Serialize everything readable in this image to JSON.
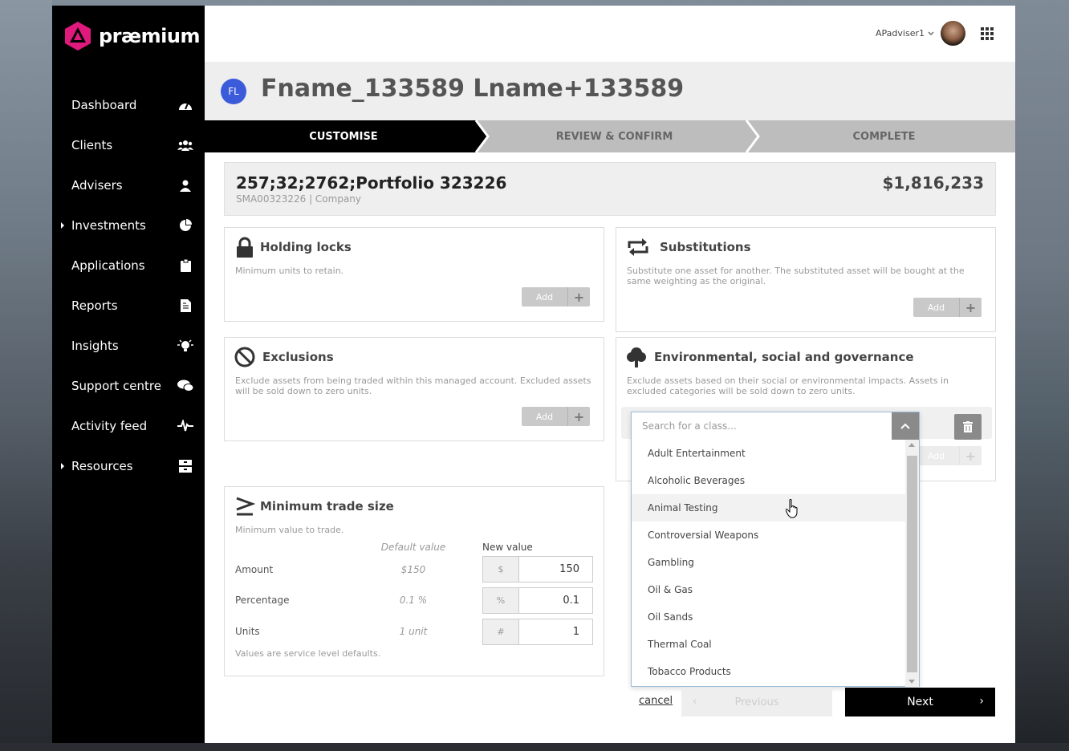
{
  "brand": {
    "name": "præmium",
    "colors": {
      "accent": "#e0197d",
      "avatar_blue": "#3b5bdb",
      "sidebar": "#000000"
    }
  },
  "topbar": {
    "username": "APadviser1",
    "apps_icon": "grid-icon"
  },
  "sidebar": {
    "items": [
      {
        "label": "Dashboard",
        "icon": "speedometer-icon"
      },
      {
        "label": "Clients",
        "icon": "users-icon"
      },
      {
        "label": "Advisers",
        "icon": "user-icon"
      },
      {
        "label": "Investments",
        "icon": "pie-chart-icon"
      },
      {
        "label": "Applications",
        "icon": "clipboard-icon"
      },
      {
        "label": "Reports",
        "icon": "document-icon"
      },
      {
        "label": "Insights",
        "icon": "lightbulb-icon"
      },
      {
        "label": "Support centre",
        "icon": "chat-icon"
      },
      {
        "label": "Activity feed",
        "icon": "pulse-icon"
      },
      {
        "label": "Resources",
        "icon": "archive-icon"
      }
    ]
  },
  "header": {
    "initials": "FL",
    "client_name": "Fname_133589 Lname+133589"
  },
  "steps": [
    "CUSTOMISE",
    "REVIEW & CONFIRM",
    "COMPLETE"
  ],
  "portfolio": {
    "title": "257;32;2762;Portfolio 323226",
    "subtitle": "SMA00323226 | Company",
    "value": "$1,816,233"
  },
  "holding_locks": {
    "title": "Holding locks",
    "desc": "Minimum units to retain.",
    "add": "Add"
  },
  "substitutions": {
    "title": "Substitutions",
    "desc": "Substitute one asset for another. The substituted asset will be bought at the same weighting as the original.",
    "add": "Add"
  },
  "exclusions": {
    "title": "Exclusions",
    "desc": "Exclude assets from being traded within this managed account. Excluded assets will be sold down to zero units.",
    "add": "Add"
  },
  "esg": {
    "title": "Environmental, social and governance",
    "desc": "Exclude assets based on their social or environmental impacts. Assets in excluded categories will be sold down to zero units.",
    "add": "Add"
  },
  "min_trade": {
    "title": "Minimum trade size",
    "desc": "Minimum value to trade.",
    "col_default": "Default value",
    "col_new": "New value",
    "rows": [
      {
        "label": "Amount",
        "default": "$150",
        "prefix": "$",
        "value": "150"
      },
      {
        "label": "Percentage",
        "default": "0.1 %",
        "prefix": "%",
        "value": "0.1"
      },
      {
        "label": "Units",
        "default": "1 unit",
        "prefix": "#",
        "value": "1"
      }
    ],
    "footnote": "Values are service level defaults."
  },
  "class_dropdown": {
    "placeholder": "Search for a class...",
    "options": [
      "Adult Entertainment",
      "Alcoholic Beverages",
      "Animal Testing",
      "Controversial Weapons",
      "Gambling",
      "Oil & Gas",
      "Oil Sands",
      "Thermal Coal",
      "Tobacco Products"
    ],
    "hovered": "Animal Testing"
  },
  "footer": {
    "cancel": "cancel",
    "previous": "Previous",
    "next": "Next"
  }
}
